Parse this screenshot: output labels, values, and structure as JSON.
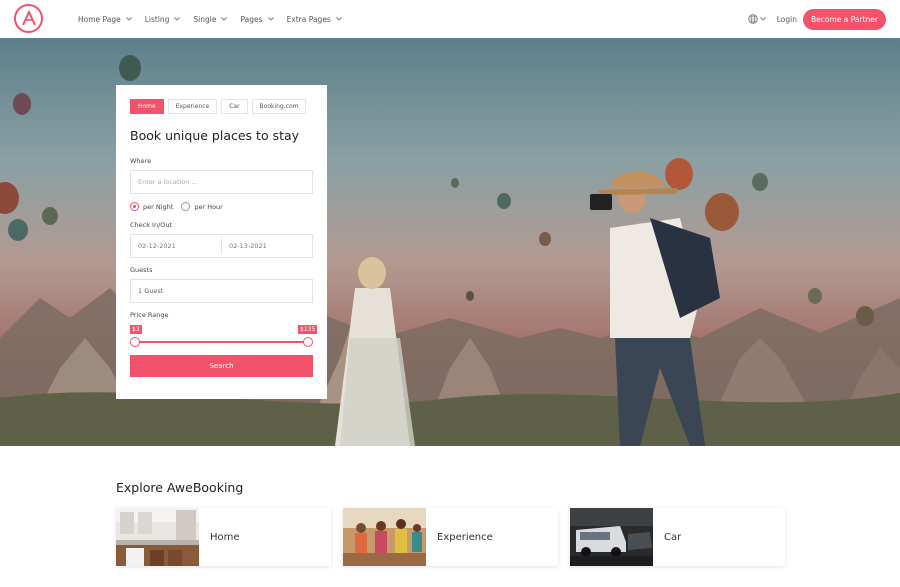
{
  "nav": {
    "menu": [
      {
        "label": "Home Page"
      },
      {
        "label": "Listing"
      },
      {
        "label": "Single"
      },
      {
        "label": "Pages"
      },
      {
        "label": "Extra Pages"
      }
    ],
    "login": "Login",
    "partner": "Become a Partner"
  },
  "search": {
    "tabs": [
      {
        "label": "Home",
        "active": true
      },
      {
        "label": "Experience"
      },
      {
        "label": "Car"
      },
      {
        "label": "Booking.com"
      }
    ],
    "title": "Book unique places to stay",
    "where_label": "Where",
    "where_placeholder": "Enter a location ...",
    "rate_options": [
      {
        "label": "per Night",
        "checked": true
      },
      {
        "label": "per Hour",
        "checked": false
      }
    ],
    "checkin_label": "Check In/Out",
    "checkin": "02-12-2021",
    "checkout": "02-13-2021",
    "guests_label": "Guests",
    "guests_value": "1 Guest",
    "price_label": "Price Range",
    "price_min": "$3",
    "price_max": "$135",
    "search_button": "Search"
  },
  "explore": {
    "title": "Explore AweBooking",
    "tiles": [
      {
        "label": "Home"
      },
      {
        "label": "Experience"
      },
      {
        "label": "Car"
      }
    ]
  },
  "colors": {
    "accent": "#f2536a"
  }
}
